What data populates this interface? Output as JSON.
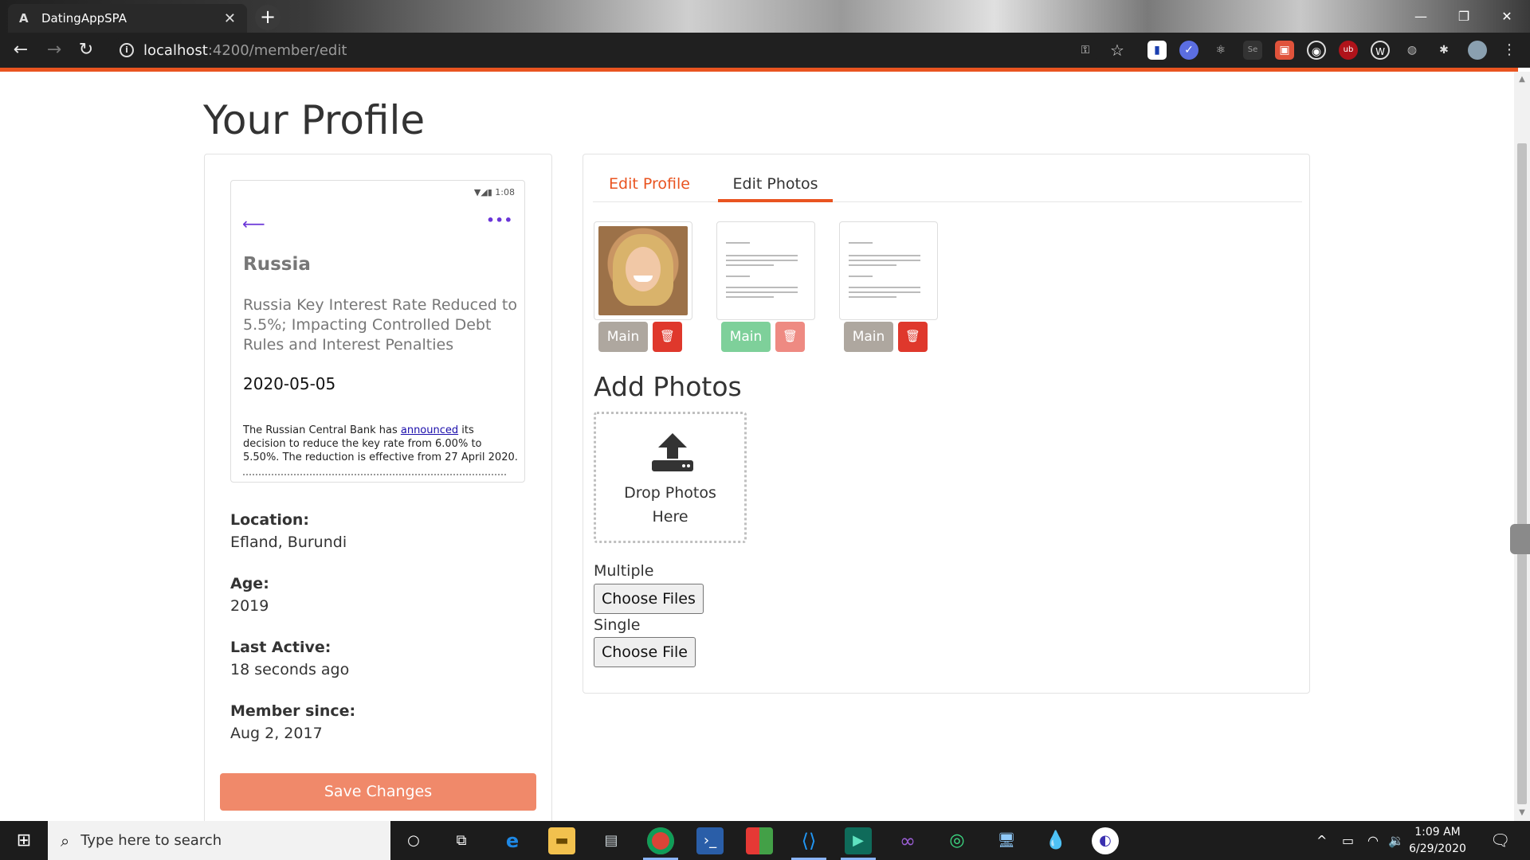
{
  "browser": {
    "tab_title": "DatingAppSPA",
    "url_host": "localhost",
    "url_path": ":4200/member/edit"
  },
  "page": {
    "title": "Your Profile"
  },
  "preview": {
    "status_time": "1:08",
    "heading": "Russia",
    "headline": "Russia Key Interest Rate Reduced to 5.5%; Impacting Controlled Debt Rules and Interest Penalties",
    "date": "2020-05-05",
    "body_before_link": "The Russian Central Bank has ",
    "body_link": "announced",
    "body_after_link": " its decision to reduce the key rate from 6.00% to 5.50%. The reduction is effective from 27 April 2020."
  },
  "member": {
    "location_label": "Location:",
    "location_value": "Efland, Burundi",
    "age_label": "Age:",
    "age_value": "2019",
    "last_active_label": "Last Active:",
    "last_active_value": "18 seconds ago",
    "member_since_label": "Member since:",
    "member_since_value": "Aug 2, 2017",
    "save_label": "Save Changes"
  },
  "tabs": {
    "edit_profile": "Edit Profile",
    "edit_photos": "Edit Photos"
  },
  "photos": [
    {
      "main_label": "Main",
      "is_main": false
    },
    {
      "main_label": "Main",
      "is_main": true
    },
    {
      "main_label": "Main",
      "is_main": false
    }
  ],
  "add_photos": {
    "title": "Add Photos",
    "drop_line1": "Drop Photos",
    "drop_line2": "Here",
    "multiple_label": "Multiple",
    "multiple_button": "Choose Files",
    "single_label": "Single",
    "single_button": "Choose File"
  },
  "taskbar": {
    "search_placeholder": "Type here to search",
    "time": "1:09 AM",
    "date": "6/29/2020"
  },
  "colors": {
    "accent": "#e95420",
    "save_button": "#f0896a",
    "main_button_inactive": "#aea79f",
    "main_button_active": "#7ed09a",
    "delete_button": "#df382c",
    "delete_button_disabled": "#ee8a82"
  }
}
